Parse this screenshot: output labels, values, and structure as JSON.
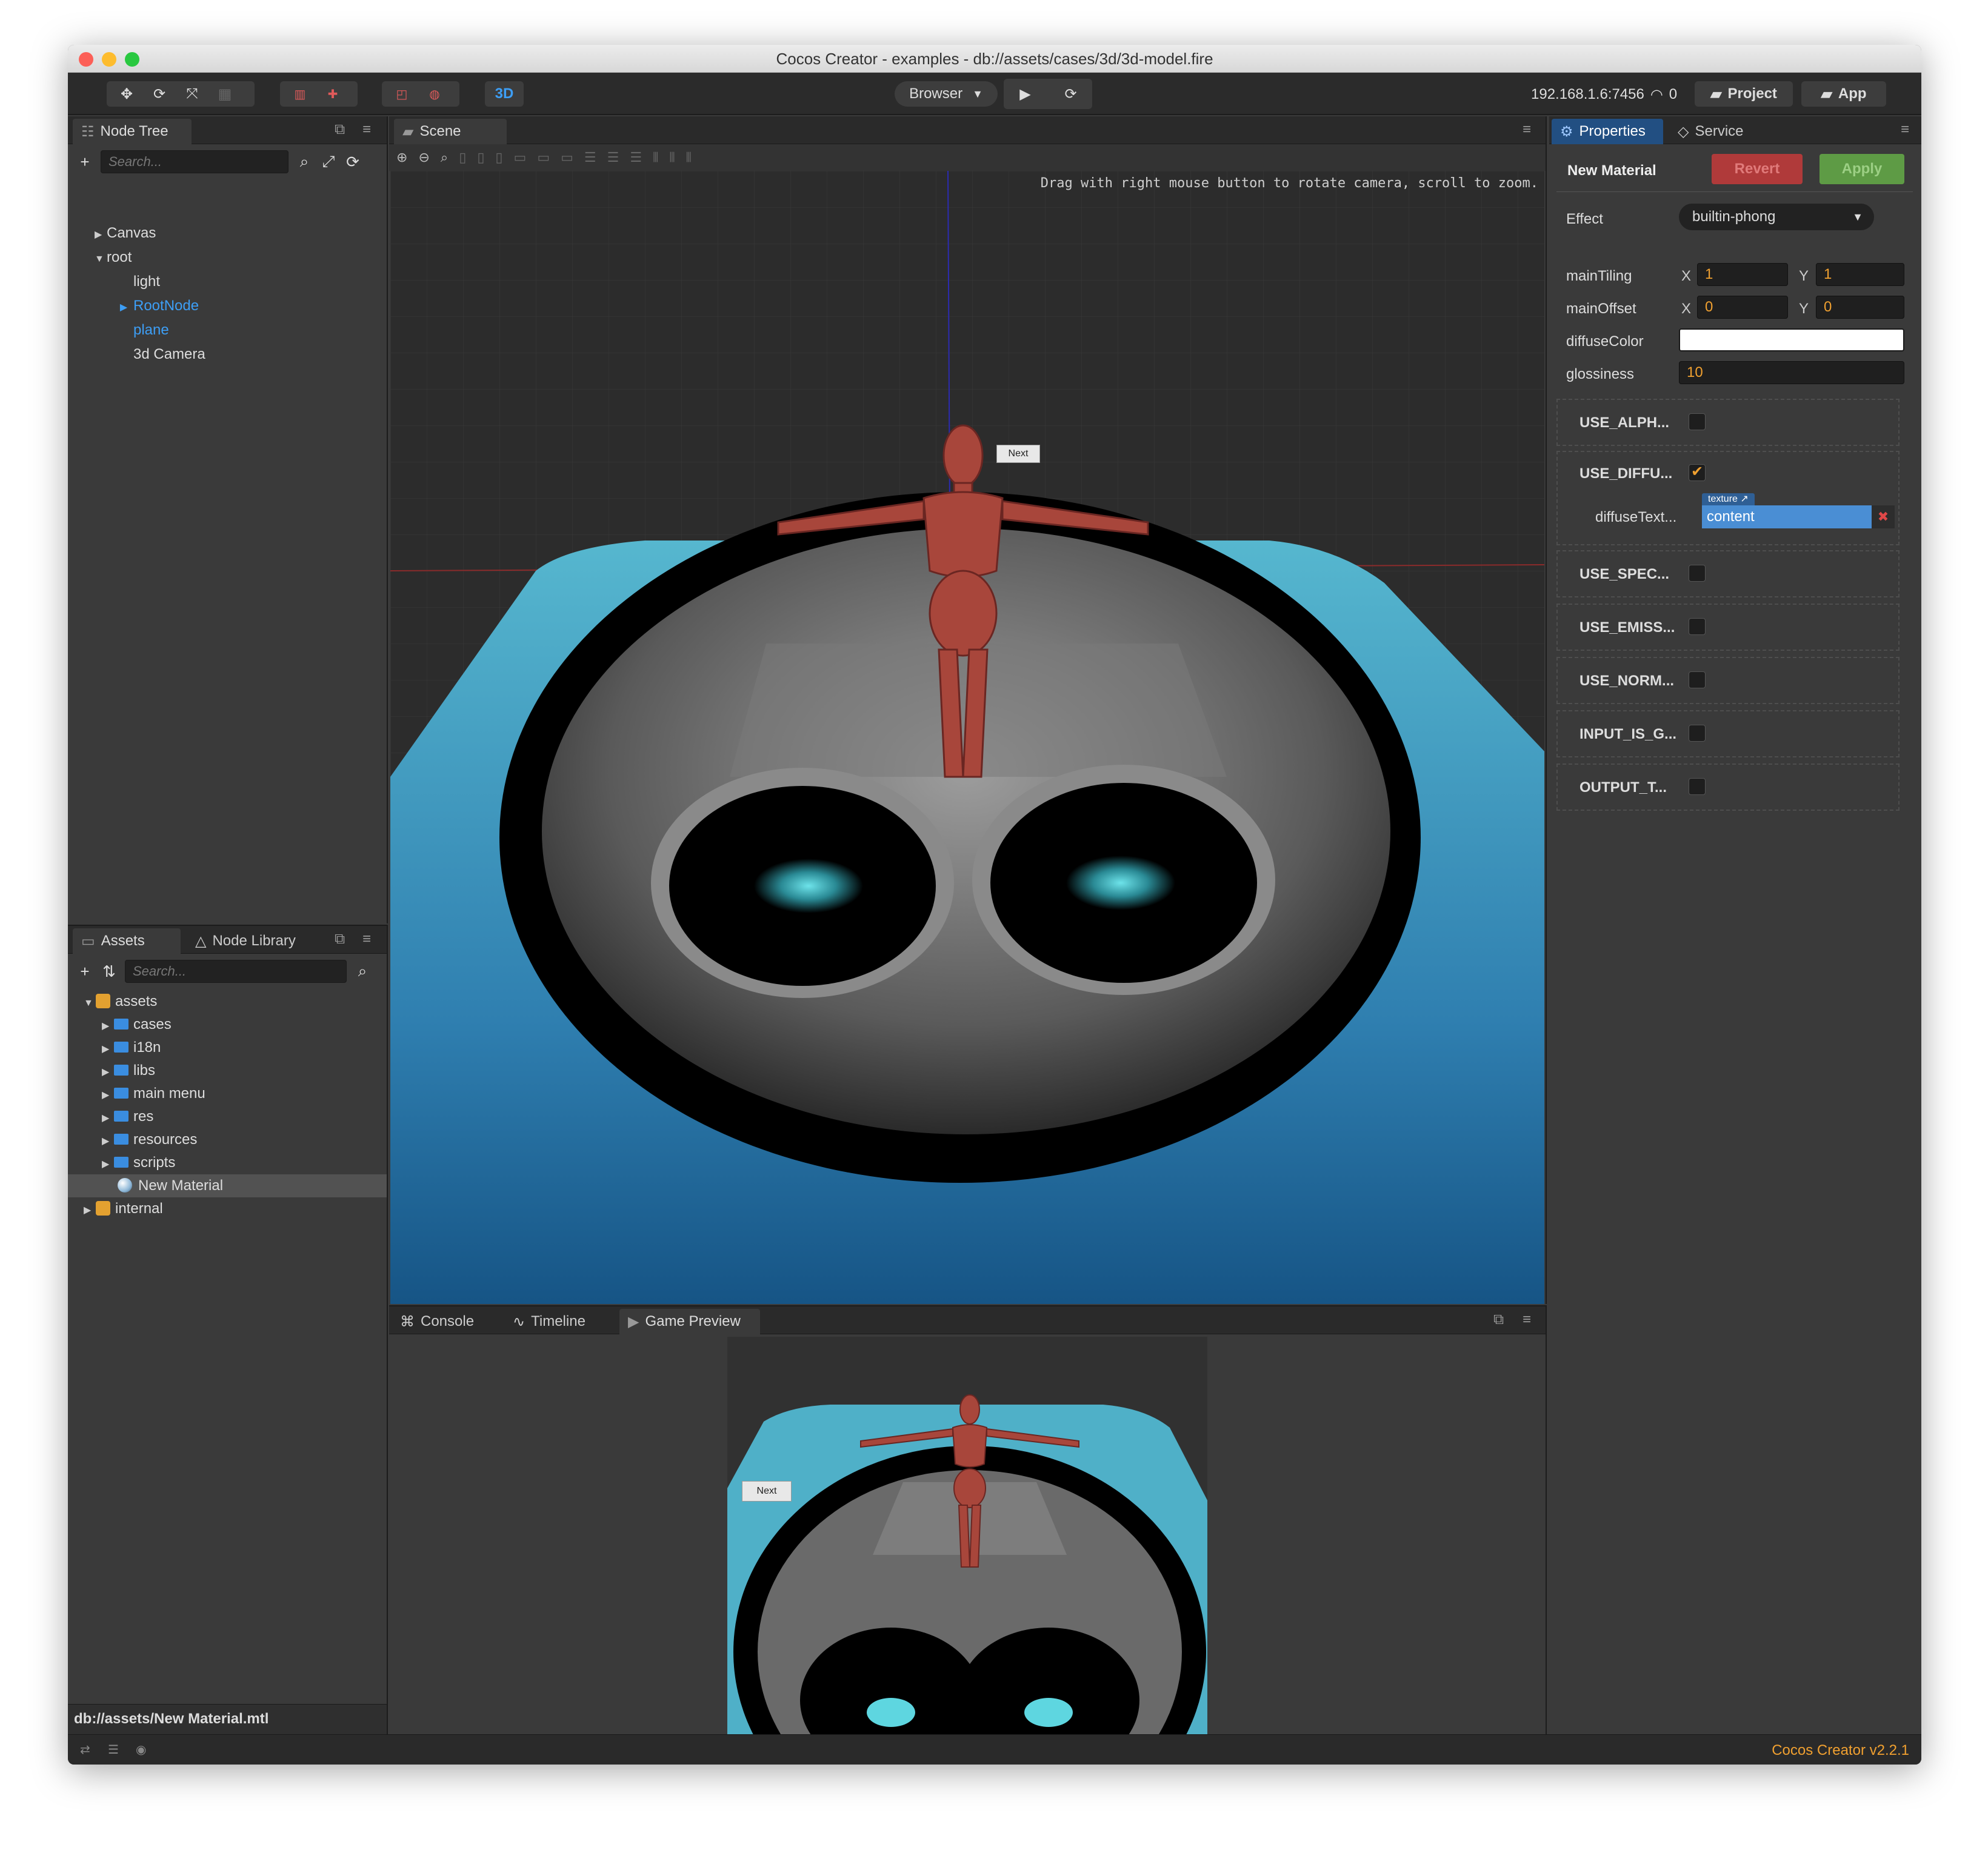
{
  "window": {
    "title": "Cocos Creator - examples - db://assets/cases/3d/3d-model.fire"
  },
  "toolbar": {
    "browser_label": "Browser",
    "mode_3d_label": "3D",
    "ip_address": "192.168.1.6:7456",
    "connection_count": "0",
    "project_label": "Project",
    "app_label": "App"
  },
  "node_tree": {
    "tab_label": "Node Tree",
    "search_placeholder": "Search...",
    "items": [
      {
        "label": "Canvas"
      },
      {
        "label": "root"
      },
      {
        "label": "light"
      },
      {
        "label": "RootNode"
      },
      {
        "label": "plane"
      },
      {
        "label": "3d Camera"
      }
    ]
  },
  "assets": {
    "tab_label": "Assets",
    "node_library_label": "Node Library",
    "search_placeholder": "Search...",
    "items": [
      {
        "label": "assets"
      },
      {
        "label": "cases"
      },
      {
        "label": "i18n"
      },
      {
        "label": "libs"
      },
      {
        "label": "main menu"
      },
      {
        "label": "res"
      },
      {
        "label": "resources"
      },
      {
        "label": "scripts"
      },
      {
        "label": "New Material"
      },
      {
        "label": "internal"
      }
    ],
    "selected_path": "db://assets/New Material.mtl"
  },
  "scene": {
    "tab_label": "Scene",
    "hint": "Drag with right mouse button to rotate camera, scroll to zoom.",
    "next_label": "Next"
  },
  "bottom_panel": {
    "tabs": [
      {
        "label": "Console"
      },
      {
        "label": "Timeline"
      },
      {
        "label": "Game Preview"
      }
    ],
    "next_label": "Next"
  },
  "properties": {
    "tab_label": "Properties",
    "service_label": "Service",
    "material_name": "New Material",
    "revert_label": "Revert",
    "apply_label": "Apply",
    "effect_label": "Effect",
    "effect_value": "builtin-phong",
    "main_tiling_label": "mainTiling",
    "main_tiling_x": "1",
    "main_tiling_y": "1",
    "main_offset_label": "mainOffset",
    "main_offset_x": "0",
    "main_offset_y": "0",
    "x_label": "X",
    "y_label": "Y",
    "diffuse_color_label": "diffuseColor",
    "diffuse_color_value": "#ffffff",
    "glossiness_label": "glossiness",
    "glossiness_value": "10",
    "defines": [
      {
        "label": "USE_ALPH...",
        "checked": false
      },
      {
        "label": "USE_DIFFU...",
        "checked": true
      },
      {
        "label": "USE_SPEC...",
        "checked": false
      },
      {
        "label": "USE_EMISS...",
        "checked": false
      },
      {
        "label": "USE_NORM...",
        "checked": false
      },
      {
        "label": "INPUT_IS_G...",
        "checked": false
      },
      {
        "label": "OUTPUT_T...",
        "checked": false
      }
    ],
    "diffuse_texture_label": "diffuseText...",
    "texture_badge": "texture",
    "diffuse_texture_value": "content"
  },
  "status": {
    "version": "Cocos Creator v2.2.1"
  },
  "colors": {
    "accent_blue": "#3d9ef5",
    "orange": "#f0a030",
    "revert_red": "#b03a3a",
    "apply_green": "#5e9b45",
    "tab_blue": "#224f82"
  }
}
